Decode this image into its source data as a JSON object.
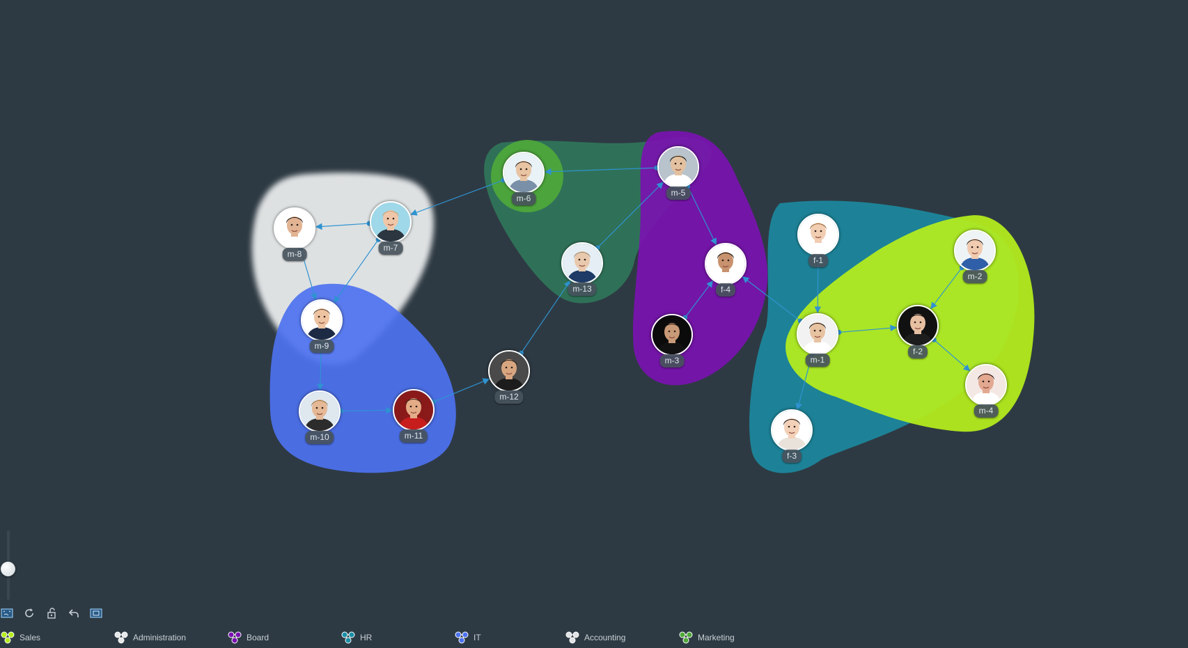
{
  "groups": [
    {
      "id": "sales",
      "label": "Sales",
      "color": "#b5ee1c",
      "opacity": 0.93
    },
    {
      "id": "administration",
      "label": "Administration",
      "color": "#e6e8e9",
      "opacity": 0.95
    },
    {
      "id": "board",
      "label": "Board",
      "color": "#7a12b0",
      "opacity": 0.9
    },
    {
      "id": "hr",
      "label": "HR",
      "color": "#1a8fa6",
      "opacity": 0.85
    },
    {
      "id": "it",
      "label": "IT",
      "color": "#4d72f0",
      "opacity": 0.9
    },
    {
      "id": "accounting",
      "label": "Accounting",
      "color": "#e0e3e5",
      "opacity": 0.9
    },
    {
      "id": "marketing",
      "label": "Marketing",
      "color": "#4fa83a",
      "opacity": 0.9
    }
  ],
  "nodes": [
    {
      "id": "m-1",
      "label": "m-1",
      "skin": "#e7c3a1",
      "hair": "#2a221c",
      "shirt": "#ffffff",
      "bg": "#f2f2f2"
    },
    {
      "id": "m-2",
      "label": "m-2",
      "skin": "#f0cbb0",
      "hair": "#3b2c22",
      "shirt": "#2f5fa8",
      "bg": "#eef3f5"
    },
    {
      "id": "m-3",
      "label": "m-3",
      "skin": "#c99a78",
      "hair": "#1b1410",
      "shirt": "#111111",
      "bg": "#0b0b0b"
    },
    {
      "id": "m-4",
      "label": "m-4",
      "skin": "#e2a890",
      "hair": "#2b1b14",
      "shirt": "#ffffff",
      "bg": "#f4e8e4"
    },
    {
      "id": "m-5",
      "label": "m-5",
      "skin": "#e3c1a0",
      "hair": "#1f1a17",
      "shirt": "#ffffff",
      "bg": "#b8c3cc"
    },
    {
      "id": "m-6",
      "label": "m-6",
      "skin": "#e8c4a3",
      "hair": "#3a2a20",
      "shirt": "#7a8fa8",
      "bg": "#e9f2f6"
    },
    {
      "id": "m-7",
      "label": "m-7",
      "skin": "#f0c6a8",
      "hair": "#c9a47a",
      "shirt": "#2b3640",
      "bg": "#9fd8e8"
    },
    {
      "id": "m-8",
      "label": "m-8",
      "skin": "#e2b493",
      "hair": "#2a1e16",
      "shirt": "#ffffff",
      "bg": "#ffffff"
    },
    {
      "id": "m-9",
      "label": "m-9",
      "skin": "#edc3a1",
      "hair": "#6b4d34",
      "shirt": "#1c2a44",
      "bg": "#ffffff"
    },
    {
      "id": "m-10",
      "label": "m-10",
      "skin": "#e5b896",
      "hair": "#9d7a4d",
      "shirt": "#2c2c2c",
      "bg": "#dfe8ef"
    },
    {
      "id": "m-11",
      "label": "m-11",
      "skin": "#e4ab87",
      "hair": "#3b2418",
      "shirt": "#c81d1d",
      "bg": "#8a1a1a"
    },
    {
      "id": "m-12",
      "label": "m-12",
      "skin": "#d7a680",
      "hair": "#2a211a",
      "shirt": "#1c1c1c",
      "bg": "#4a4a4a"
    },
    {
      "id": "m-13",
      "label": "m-13",
      "skin": "#e9c9ad",
      "hair": "#a08c72",
      "shirt": "#1d3b66",
      "bg": "#e5eef4"
    },
    {
      "id": "f-1",
      "label": "f-1",
      "skin": "#f1cdb2",
      "hair": "#9b6a3a",
      "shirt": "#ffffff",
      "bg": "#ffffff"
    },
    {
      "id": "f-2",
      "label": "f-2",
      "skin": "#e7c0a2",
      "hair": "#1a120d",
      "shirt": "#1d1d1d",
      "bg": "#111111"
    },
    {
      "id": "f-3",
      "label": "f-3",
      "skin": "#f2d1b8",
      "hair": "#2a1a14",
      "shirt": "#e9e2da",
      "bg": "#ffffff"
    },
    {
      "id": "f-4",
      "label": "f-4",
      "skin": "#c8926e",
      "hair": "#1a120e",
      "shirt": "#ffffff",
      "bg": "#ffffff"
    }
  ],
  "edges": [
    [
      "m-5",
      "m-6"
    ],
    [
      "m-6",
      "m-7"
    ],
    [
      "m-7",
      "m-8"
    ],
    [
      "m-7",
      "m-9"
    ],
    [
      "m-8",
      "m-9"
    ],
    [
      "m-9",
      "m-10"
    ],
    [
      "m-10",
      "m-11"
    ],
    [
      "m-11",
      "m-12"
    ],
    [
      "m-12",
      "m-13"
    ],
    [
      "m-13",
      "m-5"
    ],
    [
      "m-5",
      "f-4"
    ],
    [
      "m-3",
      "f-4"
    ],
    [
      "m-1",
      "f-4"
    ],
    [
      "f-1",
      "m-1"
    ],
    [
      "m-1",
      "f-2"
    ],
    [
      "m-2",
      "f-2"
    ],
    [
      "f-2",
      "m-4"
    ],
    [
      "m-1",
      "f-3"
    ]
  ],
  "toolbar": [
    {
      "id": "fit-view",
      "icon": "fit-view-icon"
    },
    {
      "id": "refresh",
      "icon": "refresh-icon"
    },
    {
      "id": "unlock",
      "icon": "unlock-icon"
    },
    {
      "id": "undo",
      "icon": "undo-icon"
    },
    {
      "id": "overview",
      "icon": "overview-icon"
    }
  ],
  "zoom": {
    "level": 0.45
  },
  "colors": {
    "background": "#2e3a43",
    "edge": "#2f93d1"
  }
}
